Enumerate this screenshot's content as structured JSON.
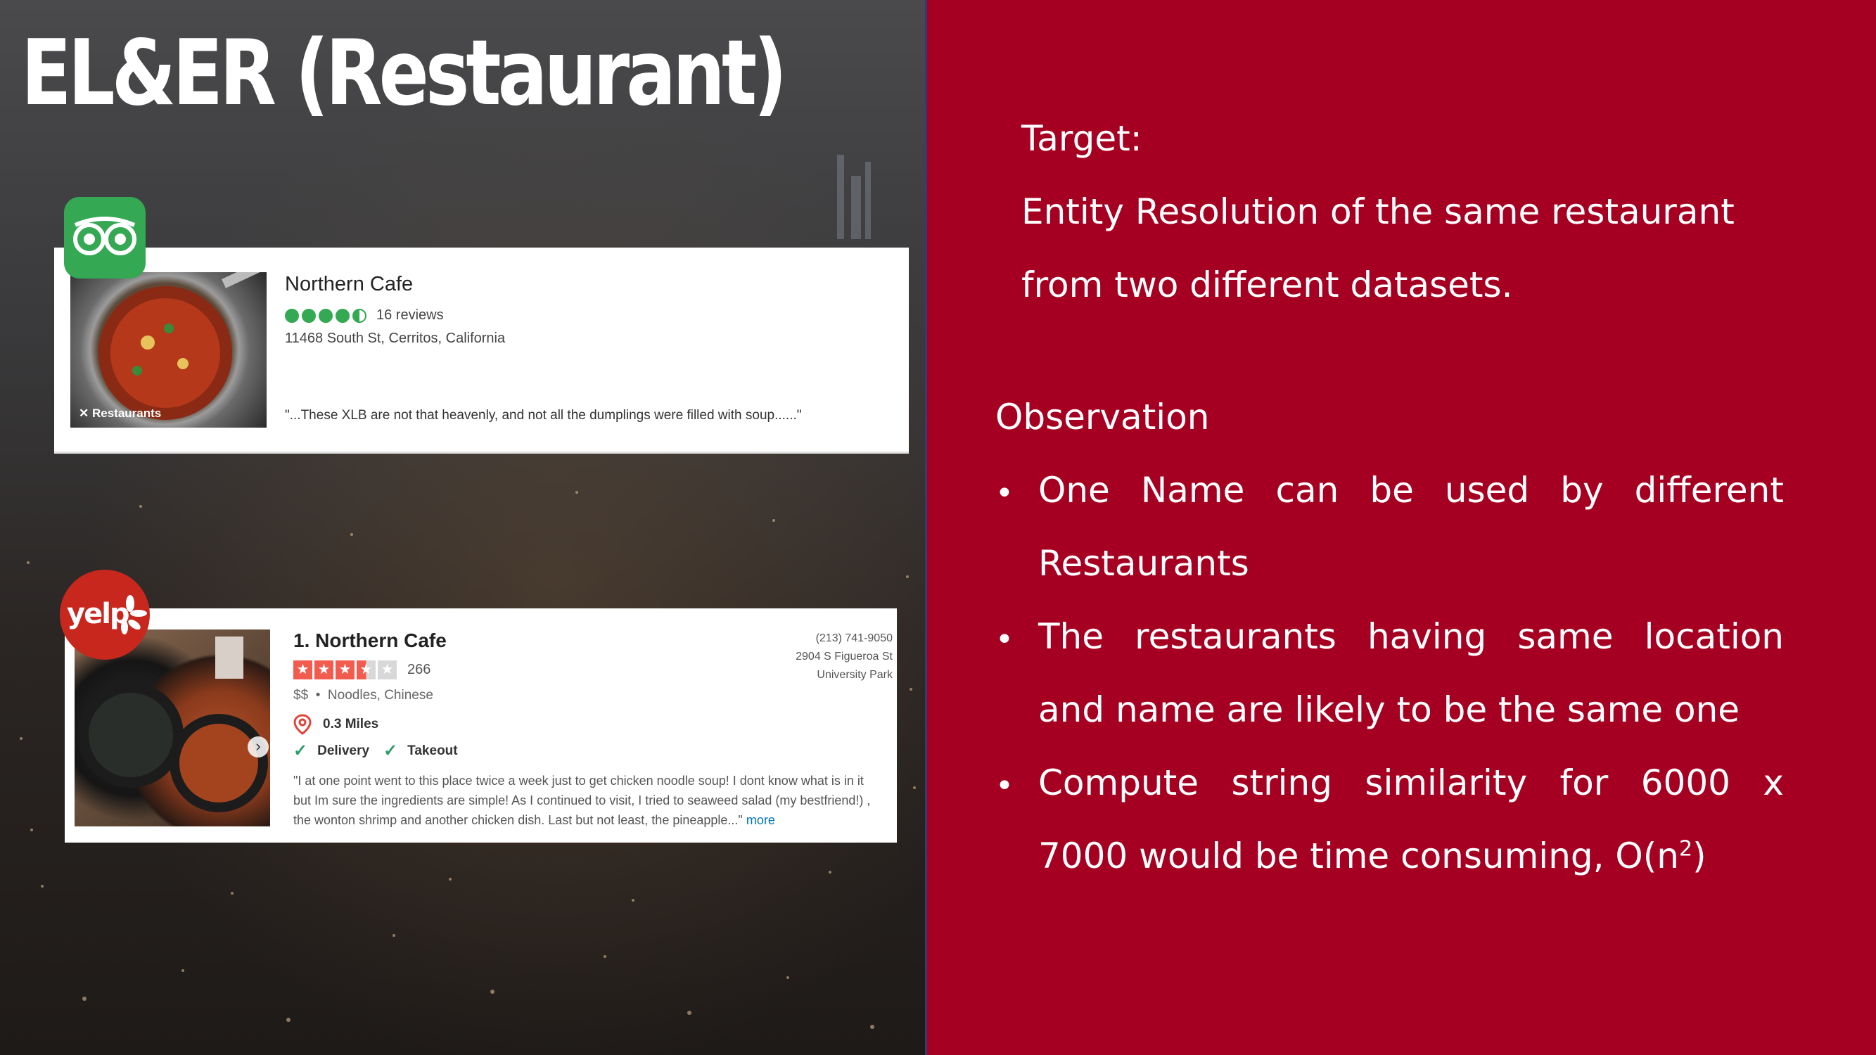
{
  "slide": {
    "title": "EL&ER (Restaurant)"
  },
  "tripadvisor_card": {
    "name": "Northern Cafe",
    "rating_dots": 4.5,
    "reviews": "16 reviews",
    "address": "11468 South St, Cerritos, California",
    "photo_label": "Restaurants",
    "quote": "\"...These XLB are not that heavenly, and not all the dumplings were filled with soup......\""
  },
  "yelp_card": {
    "badge_text": "yelp",
    "name": "1. Northern Cafe",
    "stars": 3.5,
    "review_count": "266",
    "price": "$$",
    "categories": "Noodles, Chinese",
    "distance": "0.3 Miles",
    "tags": [
      "Delivery",
      "Takeout"
    ],
    "phone": "(213) 741-9050",
    "address_line1": "2904 S Figueroa St",
    "address_line2": "University Park",
    "review": "\"I at one point went to this place twice a week just to get chicken noodle soup! I dont know what is in it but Im sure the ingredients are simple! As I continued to visit, I tried to seaweed salad (my bestfriend!) , the wonton shrimp and another chicken dish. Last but not least, the pineapple...\"",
    "more": "more"
  },
  "content": {
    "target_heading": "Target:",
    "target_line1": "Entity Resolution of the same restaurant",
    "target_line2": "from two different datasets.",
    "observation_heading": "Observation",
    "bullet1_line1_words": [
      "One",
      "Name",
      "can",
      "be",
      "used",
      "by",
      "different"
    ],
    "bullet1_line2": "Restaurants",
    "bullet2_line1_words": [
      "The",
      "restaurants",
      "having",
      "same",
      "location"
    ],
    "bullet2_line2": "and name are likely to be the same one",
    "bullet3_line1_words": [
      "Compute",
      "string",
      "similarity",
      "for",
      "6000",
      "x"
    ],
    "bullet3_line2": "7000 would be time consuming, O(n",
    "bullet3_sup": "2",
    "bullet3_end": ")"
  }
}
